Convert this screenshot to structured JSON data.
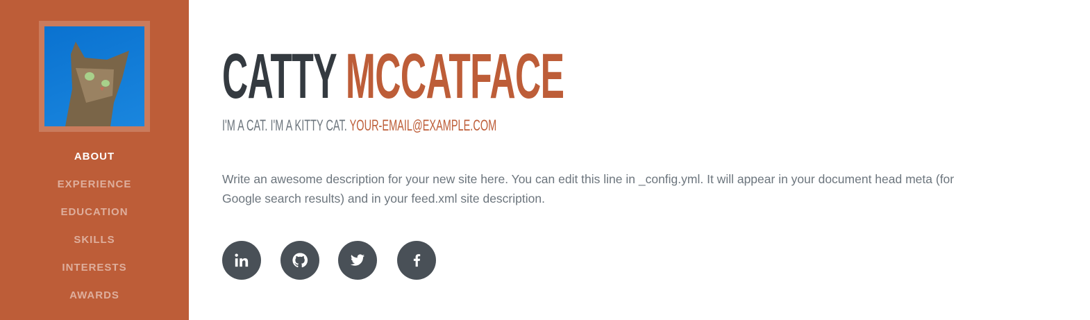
{
  "sidebar": {
    "nav": [
      {
        "label": "ABOUT",
        "active": true
      },
      {
        "label": "EXPERIENCE"
      },
      {
        "label": "EDUCATION"
      },
      {
        "label": "SKILLS"
      },
      {
        "label": "INTERESTS"
      },
      {
        "label": "AWARDS"
      }
    ]
  },
  "header": {
    "first_name": "CATTY",
    "last_name": "MCCATFACE",
    "subtitle": "I'M A CAT. I'M A KITTY CAT.",
    "email": "YOUR-EMAIL@EXAMPLE.COM"
  },
  "description": "Write an awesome description for your new site here. You can edit this line in _config.yml. It will appear in your document head meta (for Google search results) and in your feed.xml site description.",
  "social": [
    "linkedin-icon",
    "github-icon",
    "twitter-icon",
    "facebook-icon"
  ],
  "colors": {
    "primary": "#bd5d38",
    "dark": "#343a40",
    "muted": "#6c757d",
    "icon_bg": "#495057"
  }
}
